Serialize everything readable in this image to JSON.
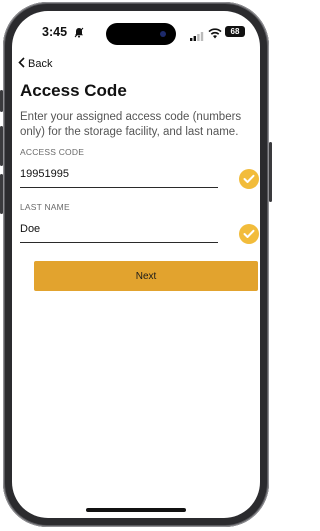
{
  "status_bar": {
    "time": "3:45",
    "battery": "68"
  },
  "nav": {
    "back_label": "Back"
  },
  "page": {
    "title": "Access Code",
    "description": "Enter your assigned access code (numbers only) for the storage facility, and last name."
  },
  "form": {
    "access_code_label": "ACCESS CODE",
    "access_code_value": "19951995",
    "last_name_label": "LAST NAME",
    "last_name_value": "Doe"
  },
  "actions": {
    "next_label": "Next"
  },
  "colors": {
    "accent": "#e2a32e",
    "check": "#f2bc3b"
  },
  "icons": [
    "bell-icon",
    "signal-icon",
    "wifi-icon",
    "battery-icon",
    "back-chevron-icon",
    "check-icon"
  ]
}
